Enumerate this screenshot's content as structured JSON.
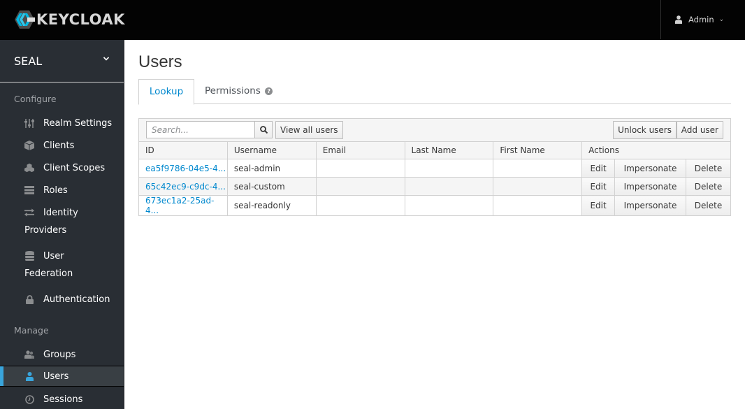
{
  "header": {
    "logo_text": "KEYCLOAK",
    "user_label": "Admin"
  },
  "sidebar": {
    "realm": "SEAL",
    "sections": {
      "configure": "Configure",
      "manage": "Manage"
    },
    "configure_items": [
      {
        "label": "Realm Settings",
        "icon": "sliders-icon"
      },
      {
        "label": "Clients",
        "icon": "cube-icon"
      },
      {
        "label": "Client Scopes",
        "icon": "cubes-icon"
      },
      {
        "label": "Roles",
        "icon": "list-icon"
      },
      {
        "label": "Identity",
        "label2": "Providers",
        "icon": "exchange-icon"
      },
      {
        "label": "User",
        "label2": "Federation",
        "icon": "database-icon"
      },
      {
        "label": "Authentication",
        "icon": "lock-icon"
      }
    ],
    "manage_items": [
      {
        "label": "Groups",
        "icon": "users-icon"
      },
      {
        "label": "Users",
        "icon": "user-icon",
        "active": true
      },
      {
        "label": "Sessions",
        "icon": "clock-icon"
      }
    ],
    "active_color": "#39a5dc"
  },
  "main": {
    "title": "Users",
    "tabs": [
      {
        "label": "Lookup",
        "active": true
      },
      {
        "label": "Permissions",
        "help": "?"
      }
    ],
    "toolbar": {
      "search_placeholder": "Search...",
      "view_all": "View all users",
      "unlock": "Unlock users",
      "add": "Add user"
    },
    "table": {
      "columns": [
        "ID",
        "Username",
        "Email",
        "Last Name",
        "First Name",
        "Actions"
      ],
      "rows": [
        {
          "id": "ea5f9786-04e5-4...",
          "username": "seal-admin",
          "email": "",
          "last_name": "",
          "first_name": ""
        },
        {
          "id": "65c42ec9-c9dc-4...",
          "username": "seal-custom",
          "email": "",
          "last_name": "",
          "first_name": ""
        },
        {
          "id": "673ec1a2-25ad-4...",
          "username": "seal-readonly",
          "email": "",
          "last_name": "",
          "first_name": ""
        }
      ],
      "actions": {
        "edit": "Edit",
        "impersonate": "Impersonate",
        "delete": "Delete"
      }
    }
  }
}
